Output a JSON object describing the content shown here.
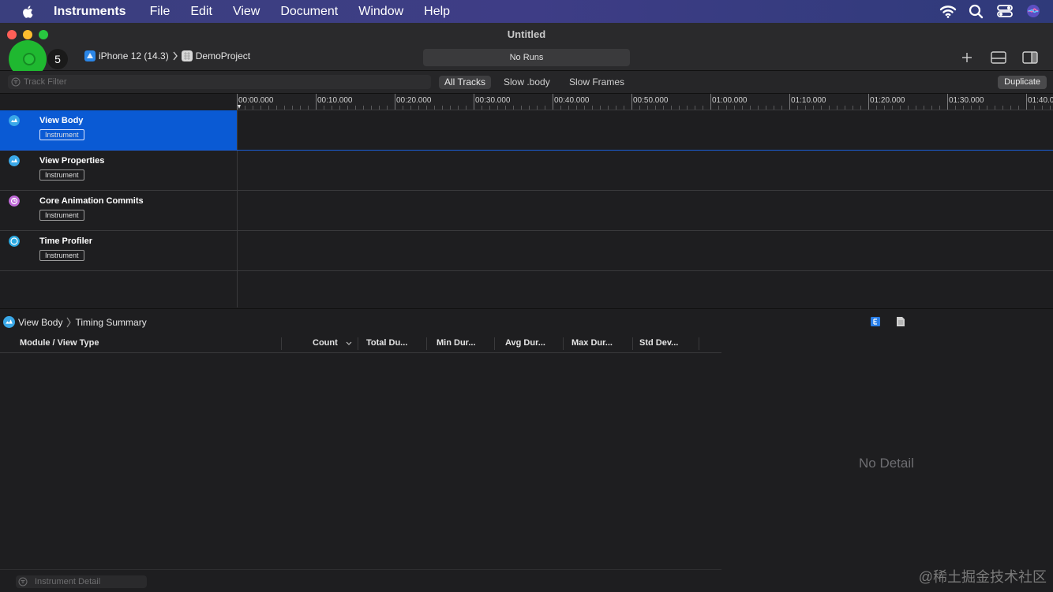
{
  "menubar": {
    "app_name": "Instruments",
    "items": [
      "File",
      "Edit",
      "View",
      "Document",
      "Window",
      "Help"
    ]
  },
  "window": {
    "title": "Untitled",
    "run_count": "5",
    "device": "iPhone 12 (14.3)",
    "target_app": "DemoProject",
    "runs_label": "No Runs"
  },
  "filterbar": {
    "track_filter_placeholder": "Track Filter",
    "segments": [
      "All Tracks",
      "Slow .body",
      "Slow Frames"
    ],
    "duplicate_label": "Duplicate"
  },
  "timeline": {
    "ticks": [
      "00:00.000",
      "00:10.000",
      "00:20.000",
      "00:30.000",
      "00:40.000",
      "00:50.000",
      "01:00.000",
      "01:10.000",
      "01:20.000",
      "01:30.000",
      "01:40.0"
    ]
  },
  "tracks": [
    {
      "name": "View Body",
      "tag": "Instrument",
      "icon_color": "#3aa8e8",
      "selected": true
    },
    {
      "name": "View Properties",
      "tag": "Instrument",
      "icon_color": "#3aa8e8",
      "selected": false
    },
    {
      "name": "Core Animation Commits",
      "tag": "Instrument",
      "icon_color": "#c06ad8",
      "selected": false
    },
    {
      "name": "Time Profiler",
      "tag": "Instrument",
      "icon_color": "#2aa8e0",
      "selected": false
    }
  ],
  "detail": {
    "breadcrumb_instrument": "View Body",
    "breadcrumb_view": "Timing Summary",
    "columns": [
      "Module / View Type",
      "Count",
      "Total Du...",
      "Min Dur...",
      "Avg Dur...",
      "Max Dur...",
      "Std Dev..."
    ],
    "no_detail": "No Detail",
    "instrument_detail_placeholder": "Instrument Detail"
  },
  "watermark": "@稀土掘金技术社区"
}
